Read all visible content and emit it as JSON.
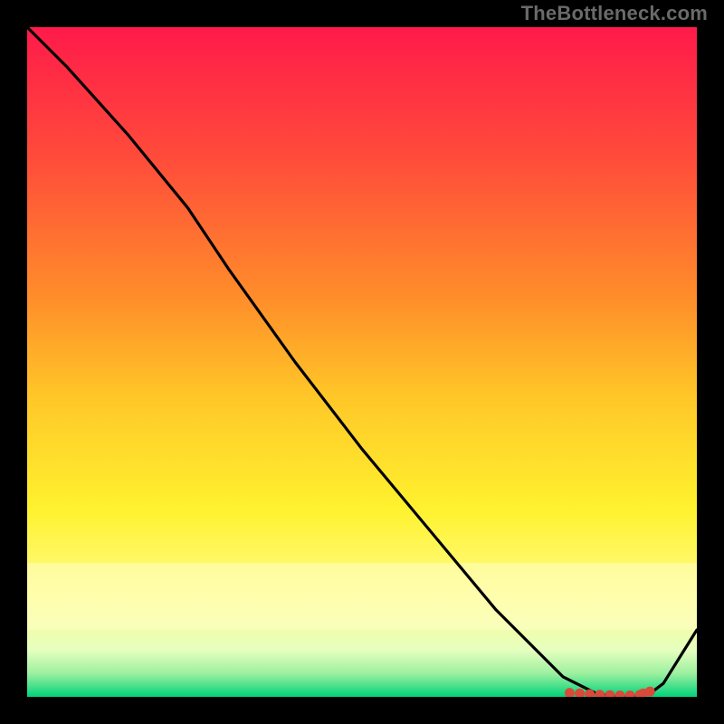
{
  "watermark": "TheBottleneck.com",
  "colors": {
    "bg": "#000000",
    "curve": "#000000",
    "dot": "#d84a3a",
    "watermark": "#6a6a6a"
  },
  "chart_data": {
    "type": "line",
    "title": "",
    "xlabel": "",
    "ylabel": "",
    "xlim": [
      0,
      100
    ],
    "ylim": [
      0,
      100
    ],
    "background_gradient": {
      "direction": "vertical",
      "stops": [
        {
          "pos": 0.0,
          "color": "#ff1a4a"
        },
        {
          "pos": 0.2,
          "color": "#ff4d3a"
        },
        {
          "pos": 0.4,
          "color": "#ff8c2a"
        },
        {
          "pos": 0.55,
          "color": "#ffc628"
        },
        {
          "pos": 0.72,
          "color": "#fff22e"
        },
        {
          "pos": 0.85,
          "color": "#fffc8a"
        },
        {
          "pos": 0.93,
          "color": "#e6ffbf"
        },
        {
          "pos": 0.965,
          "color": "#9df0a0"
        },
        {
          "pos": 1.0,
          "color": "#00d37a"
        }
      ],
      "light_band": {
        "from": 0.8,
        "to": 0.9,
        "color": "#ffffc8"
      }
    },
    "series": [
      {
        "name": "bottleneck-curve",
        "x": [
          0,
          6,
          15,
          24,
          30,
          40,
          50,
          60,
          70,
          80,
          85,
          88,
          90,
          93,
          95,
          100
        ],
        "y": [
          100,
          94,
          84,
          73,
          64,
          50,
          37,
          25,
          13,
          3,
          0.5,
          0,
          0,
          0.5,
          2,
          10
        ]
      }
    ],
    "scatter": {
      "name": "optimal-zone",
      "x": [
        81,
        82.5,
        84,
        85.5,
        87,
        88.5,
        90,
        91.5,
        92,
        93
      ],
      "y": [
        0.6,
        0.5,
        0.4,
        0.3,
        0.25,
        0.2,
        0.2,
        0.3,
        0.5,
        0.8
      ]
    }
  }
}
